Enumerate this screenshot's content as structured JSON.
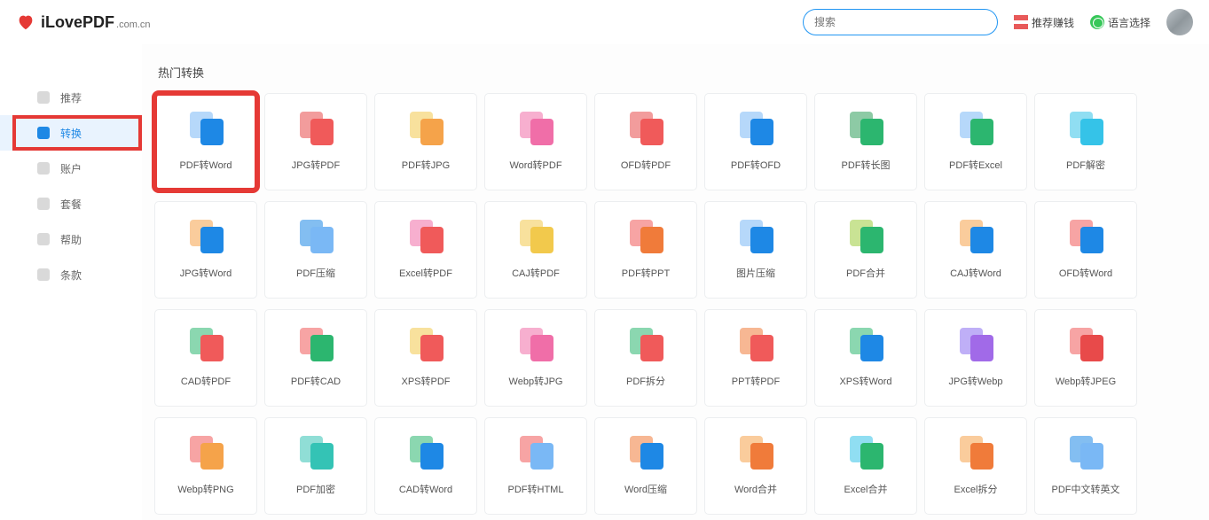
{
  "brand": {
    "name": "iLovePDF",
    "domain": ".com.cn"
  },
  "header": {
    "search_placeholder": "搜索",
    "referral": "推荐赚钱",
    "language": "语言选择"
  },
  "sidebar": {
    "items": [
      {
        "key": "recommend",
        "label": "推荐"
      },
      {
        "key": "convert",
        "label": "转换",
        "active": true
      },
      {
        "key": "account",
        "label": "账户"
      },
      {
        "key": "plan",
        "label": "套餐"
      },
      {
        "key": "help",
        "label": "帮助"
      },
      {
        "key": "terms",
        "label": "条款"
      }
    ]
  },
  "section": {
    "popular_title": "热门转换"
  },
  "cards": [
    {
      "label": "PDF转Word",
      "c1": "c-ltblue",
      "c2": "c-blue2",
      "hl": true
    },
    {
      "label": "JPG转PDF",
      "c1": "c-scarl",
      "c2": "c-red"
    },
    {
      "label": "PDF转JPG",
      "c1": "c-yellow",
      "c2": "c-orange"
    },
    {
      "label": "Word转PDF",
      "c1": "c-pink",
      "c2": "c-pink"
    },
    {
      "label": "OFD转PDF",
      "c1": "c-scarl",
      "c2": "c-red"
    },
    {
      "label": "PDF转OFD",
      "c1": "c-ltblue",
      "c2": "c-blue2"
    },
    {
      "label": "PDF转长图",
      "c1": "c-bgreen",
      "c2": "c-green"
    },
    {
      "label": "PDF转Excel",
      "c1": "c-ltblue",
      "c2": "c-green"
    },
    {
      "label": "PDF解密",
      "c1": "c-cyan",
      "c2": "c-cyan"
    },
    {
      "label": "JPG转Word",
      "c1": "c-orange",
      "c2": "c-blue2"
    },
    {
      "label": "PDF压缩",
      "c1": "c-blue2",
      "c2": "c-ltblue"
    },
    {
      "label": "Excel转PDF",
      "c1": "c-pink",
      "c2": "c-red"
    },
    {
      "label": "CAJ转PDF",
      "c1": "c-yellow",
      "c2": "c-yellow"
    },
    {
      "label": "PDF转PPT",
      "c1": "c-red",
      "c2": "c-dorange"
    },
    {
      "label": "图片压缩",
      "c1": "c-ltblue",
      "c2": "c-blue2"
    },
    {
      "label": "PDF合并",
      "c1": "c-lime",
      "c2": "c-green"
    },
    {
      "label": "CAJ转Word",
      "c1": "c-orange",
      "c2": "c-blue2"
    },
    {
      "label": "OFD转Word",
      "c1": "c-red",
      "c2": "c-blue2"
    },
    {
      "label": "CAD转PDF",
      "c1": "c-green",
      "c2": "c-red"
    },
    {
      "label": "PDF转CAD",
      "c1": "c-red",
      "c2": "c-green"
    },
    {
      "label": "XPS转PDF",
      "c1": "c-yellow",
      "c2": "c-red"
    },
    {
      "label": "Webp转JPG",
      "c1": "c-pink",
      "c2": "c-pink"
    },
    {
      "label": "PDF拆分",
      "c1": "c-green",
      "c2": "c-red"
    },
    {
      "label": "PPT转PDF",
      "c1": "c-dorange",
      "c2": "c-red"
    },
    {
      "label": "XPS转Word",
      "c1": "c-green",
      "c2": "c-blue2"
    },
    {
      "label": "JPG转Webp",
      "c1": "c-violet",
      "c2": "c-purple"
    },
    {
      "label": "Webp转JPEG",
      "c1": "c-red",
      "c2": "c-scarl"
    },
    {
      "label": "Webp转PNG",
      "c1": "c-red",
      "c2": "c-orange"
    },
    {
      "label": "PDF加密",
      "c1": "c-teal",
      "c2": "c-teal"
    },
    {
      "label": "CAD转Word",
      "c1": "c-green",
      "c2": "c-blue2"
    },
    {
      "label": "PDF转HTML",
      "c1": "c-red",
      "c2": "c-ltblue"
    },
    {
      "label": "Word压缩",
      "c1": "c-dorange",
      "c2": "c-blue2"
    },
    {
      "label": "Word合并",
      "c1": "c-orange",
      "c2": "c-dorange"
    },
    {
      "label": "Excel合并",
      "c1": "c-cyan",
      "c2": "c-green"
    },
    {
      "label": "Excel拆分",
      "c1": "c-orange",
      "c2": "c-dorange"
    },
    {
      "label": "PDF中文转英文",
      "c1": "c-blue2",
      "c2": "c-ltblue"
    }
  ]
}
